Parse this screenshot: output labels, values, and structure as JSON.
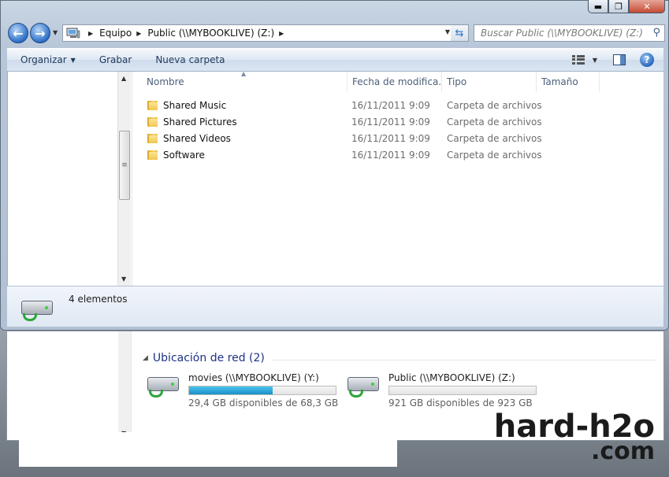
{
  "window": {
    "caption_buttons": {
      "minimize": "▬",
      "maximize": "❐",
      "close": "✕"
    }
  },
  "navbar": {
    "breadcrumbs": [
      "Equipo",
      "Public (\\\\MYBOOKLIVE) (Z:)"
    ],
    "search_placeholder": "Buscar Public (\\\\MYBOOKLIVE) (Z:)"
  },
  "toolbar": {
    "organize_label": "Organizar",
    "burn_label": "Grabar",
    "new_folder_label": "Nueva carpeta"
  },
  "file_list": {
    "columns": [
      "Nombre",
      "Fecha de modifica...",
      "Tipo",
      "Tamaño"
    ],
    "rows": [
      {
        "name": "Shared Music",
        "date": "16/11/2011 9:09",
        "type": "Carpeta de archivos"
      },
      {
        "name": "Shared Pictures",
        "date": "16/11/2011 9:09",
        "type": "Carpeta de archivos"
      },
      {
        "name": "Shared Videos",
        "date": "16/11/2011 9:09",
        "type": "Carpeta de archivos"
      },
      {
        "name": "Software",
        "date": "16/11/2011 9:09",
        "type": "Carpeta de archivos"
      }
    ]
  },
  "details": {
    "items_count": "4 elementos"
  },
  "background_window": {
    "network_header": "Ubicación de red (2)",
    "drives": [
      {
        "name": "movies (\\\\MYBOOKLIVE) (Y:)",
        "free_text": "29,4 GB disponibles de 68,3 GB",
        "used_fraction": 0.57
      },
      {
        "name": "Public (\\\\MYBOOKLIVE) (Z:)",
        "free_text": "921 GB disponibles de 923 GB",
        "used_fraction": 0.002
      }
    ]
  },
  "watermark": {
    "line1": "hard-h2o",
    "line2": ".com"
  },
  "colors": {
    "accent": "#1e3287",
    "drive_bar": "#1a8fc9",
    "folder": "#e8bd45"
  }
}
